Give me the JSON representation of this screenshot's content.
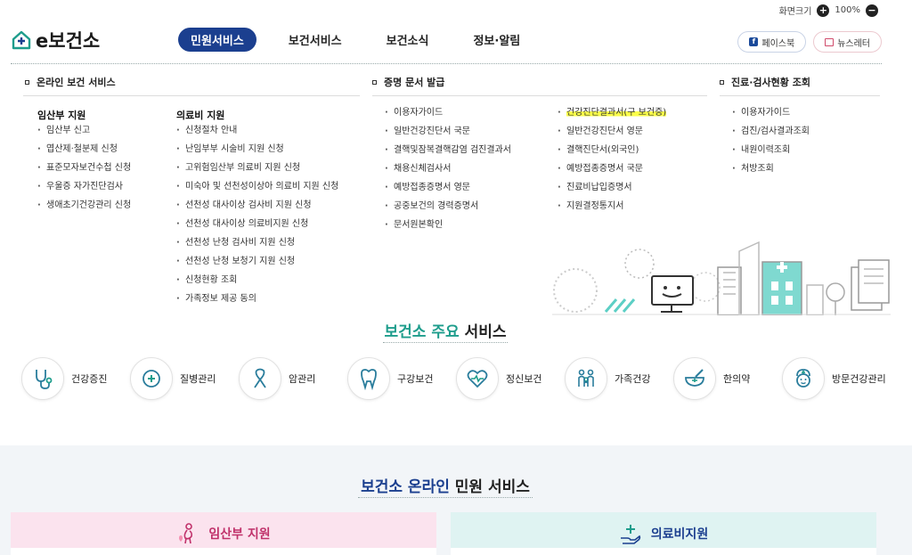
{
  "utility": {
    "zoom_label": "화면크기",
    "zoom_in": "+",
    "zoom_value": "100%",
    "zoom_out": "−"
  },
  "header": {
    "logo_text": "e보건소",
    "nav": [
      "민원서비스",
      "보건서비스",
      "보건소식",
      "정보·알림"
    ],
    "facebook_icon_letter": "f",
    "facebook_label": "페이스북",
    "newsletter_label": "뉴스레터"
  },
  "mega_menu": {
    "col1": {
      "title": "온라인 보건 서비스",
      "groups": [
        {
          "title": "임산부 지원",
          "items": [
            "임산부 신고",
            "엽산제·철분제 신청",
            "표준모자보건수첩 신청",
            "우울증 자가진단검사",
            "생애초기건강관리 신청"
          ]
        },
        {
          "title": "의료비 지원",
          "items": [
            "신청절차 안내",
            "난임부부 시술비 지원 신청",
            "고위험임산부 의료비 지원 신청",
            "미숙아 및 선천성이상아 의료비 지원 신청",
            "선천성 대사이상 검사비 지원 신청",
            "선천성 대사이상 의료비지원 신청",
            "선천성 난청 검사비 지원 신청",
            "선천성 난청 보청기 지원 신청",
            "신청현황 조회",
            "가족정보 제공 동의"
          ]
        }
      ]
    },
    "col2": {
      "title": "증명 문서 발급",
      "left_items": [
        "이용자가이드",
        "일반건강진단서 국문",
        "결핵및잠복결핵감염 검진결과서",
        "채용신체검사서",
        "예방접종증명서 영문",
        "공중보건의 경력증명서",
        "문서원본확인"
      ],
      "right_items": [
        "건강진단결과서(구 보건증)",
        "일반건강진단서 영문",
        "결핵진단서(외국인)",
        "예방접종증명서 국문",
        "진료비납입증명서",
        "지원결정통지서"
      ]
    },
    "col3": {
      "title": "진료·검사현황 조회",
      "items": [
        "이용자가이드",
        "검진/검사결과조회",
        "내원이력조회",
        "처방조회"
      ]
    }
  },
  "main_services": {
    "title_highlight": "보건소 주요",
    "title_rest": " 서비스",
    "items": [
      {
        "label": "건강증진",
        "icon": "stethoscope-icon"
      },
      {
        "label": "질병관리",
        "icon": "disease-care-icon"
      },
      {
        "label": "암관리",
        "icon": "cancer-ribbon-icon"
      },
      {
        "label": "구강보건",
        "icon": "tooth-icon"
      },
      {
        "label": "정신보건",
        "icon": "heart-pulse-icon"
      },
      {
        "label": "가족건강",
        "icon": "family-icon"
      },
      {
        "label": "한의약",
        "icon": "mortar-icon"
      },
      {
        "label": "방문건강관리",
        "icon": "nurse-icon"
      }
    ]
  },
  "online_services": {
    "title_highlight": "보건소 온라인",
    "title_rest": " 민원 서비스",
    "cards": [
      "임산부 지원",
      "의료비지원"
    ]
  },
  "colors": {
    "primary": "#1b3f8f",
    "accent_green": "#1e9d8c",
    "highlight": "#fbff4a",
    "pink": "#c0316a"
  }
}
